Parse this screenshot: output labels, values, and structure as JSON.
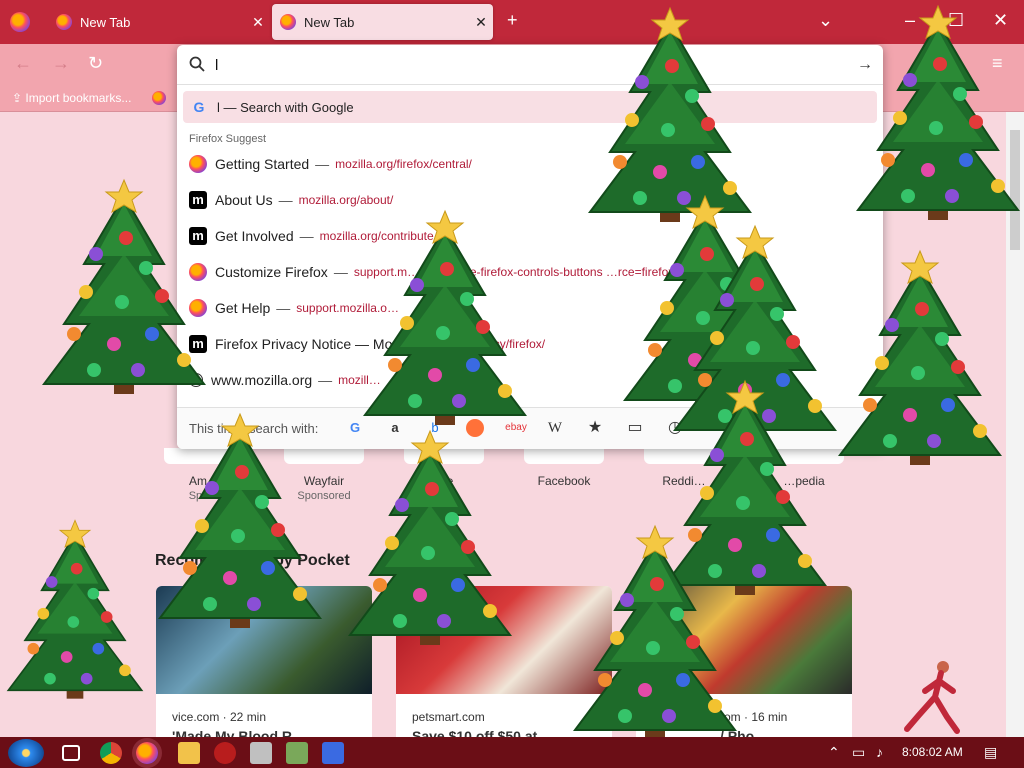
{
  "tabs": [
    {
      "label": "New Tab",
      "close": "✕"
    },
    {
      "label": "New Tab",
      "close": "✕"
    }
  ],
  "tabstrip": {
    "new_tab": "+",
    "list_tabs": "⌄",
    "minimize": "–",
    "maximize": "☐",
    "close": "✕"
  },
  "nav": {
    "back": "←",
    "forward": "→",
    "reload": "↻",
    "menu": "≡"
  },
  "bookmarks": [
    {
      "label": "Import bookmarks..."
    }
  ],
  "urlbar": {
    "value": "l",
    "go": "→"
  },
  "google_row": {
    "icon": "G",
    "text": "l — Search with Google"
  },
  "suggest_heading": "Firefox Suggest",
  "suggestions": [
    {
      "icon": "ff",
      "title": "Getting Started",
      "url": "mozilla.org/firefox/central/"
    },
    {
      "icon": "m",
      "title": "About Us",
      "url": "mozilla.org/about/"
    },
    {
      "icon": "m",
      "title": "Get Involved",
      "url": "mozilla.org/contribute"
    },
    {
      "icon": "ff",
      "title": "Customize Firefox",
      "url": "support.m… customize-firefox-controls-buttons …rce=firefox-bro"
    },
    {
      "icon": "ff",
      "title": "Get Help",
      "url": "support.mozilla.o…"
    },
    {
      "icon": "m",
      "title": "Firefox Privacy Notice — Mo…",
      "url": "…en-US/privacy/firefox/"
    },
    {
      "icon": "globe",
      "title": "www.mozilla.org",
      "url": "mozill…"
    }
  ],
  "searchwith": {
    "label": "This time, search with:",
    "engines": [
      "G",
      "a",
      "b",
      "ebay",
      "W",
      "★",
      "▭",
      "◷"
    ]
  },
  "shortcuts": [
    {
      "label": "Am…",
      "sub": "Spo…"
    },
    {
      "label": "Wayfair",
      "sub": "Sponsored"
    },
    {
      "label": "…e",
      "sub": ""
    },
    {
      "label": "Facebook",
      "sub": ""
    },
    {
      "label": "Reddi…",
      "sub": ""
    },
    {
      "label": "…pedia",
      "sub": ""
    }
  ],
  "pocket": {
    "title": "Recommended by Pocket",
    "cards": [
      {
        "source": "vice.com · 22 min",
        "title": "'Made My Blood R…"
      },
      {
        "source": "petsmart.com",
        "title": "Save $10 off $50 at…"
      },
      {
        "source": "…com · 16 min",
        "title": "…/ Pho…"
      }
    ]
  },
  "taskbar": {
    "clock": "8:08:02 AM"
  },
  "colors": {
    "tabstrip": "#c0283a",
    "toolbar": "#f2a5ae",
    "page_bg": "#f8d7de",
    "url_accent": "#b01b38",
    "taskbar": "#6b0e16"
  }
}
